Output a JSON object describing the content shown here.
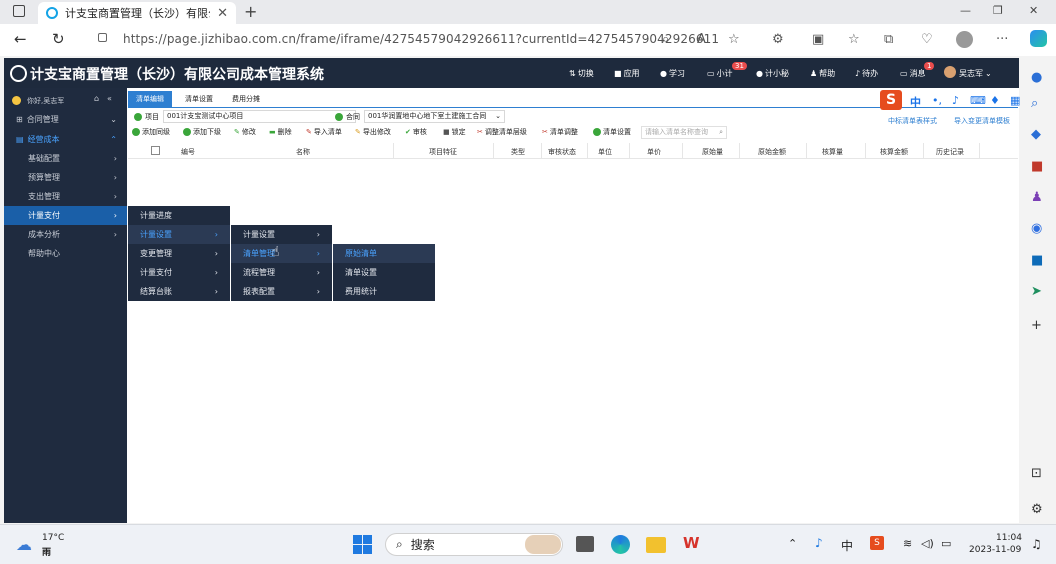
{
  "browser": {
    "tab_title": "计支宝商置管理（长沙）有限公",
    "tab_close": "✕",
    "new_tab": "+",
    "url": "https://page.jizhibao.com.cn/frame/iframe/427545790429266​11?currentId=42754579042926611",
    "window_min": "—",
    "window_max": "❐",
    "window_close": "✕",
    "more": "···"
  },
  "app": {
    "title": "计支宝商置管理（长沙）有限公司成本管理系统",
    "header": {
      "switch": "切换",
      "apps": "应用",
      "learn": "学习",
      "xiaoji": "小计",
      "xiaoji_badge": "31",
      "jixiaomi": "计小秘",
      "help": "帮助",
      "todo": "待办",
      "messages": "消息",
      "messages_badge": "1",
      "user": "吴志军"
    }
  },
  "sidebar": {
    "greeting": "你好,吴志军",
    "items": [
      {
        "label": "合同管理"
      },
      {
        "label": "经营成本"
      },
      {
        "label": "基础配置"
      },
      {
        "label": "预算管理"
      },
      {
        "label": "支出管理"
      },
      {
        "label": "计量支付"
      },
      {
        "label": "成本分析"
      },
      {
        "label": "帮助中心"
      }
    ]
  },
  "content": {
    "tabs": [
      "清单编辑",
      "清单设置",
      "费用分摊"
    ],
    "project_label": "项目",
    "project_value": "001计支宝测试中心项目",
    "contract_label": "合同",
    "contract_value": "001华润置地中心地下室土建施工合同",
    "right_links": [
      "中标清单表样式",
      "导入变更清单模板"
    ],
    "toolbar": [
      "添加同级",
      "添加下级",
      "修改",
      "删除",
      "导入清单",
      "导出修改",
      "审核",
      "锁定",
      "调整清单层级",
      "清单调整",
      "清单设置"
    ],
    "search_placeholder": "请输入清单名称查询",
    "columns": [
      "编号",
      "名称",
      "项目特征",
      "类型",
      "审核状态",
      "单位",
      "单价",
      "原始量",
      "原始金额",
      "核算量",
      "核算金额",
      "历史记录"
    ]
  },
  "menus": {
    "level1": [
      "计量进度",
      "计量设置",
      "变更管理",
      "计量支付",
      "结算台账"
    ],
    "level2": [
      "计量设置",
      "清单管理",
      "流程管理",
      "报表配置"
    ],
    "level3": [
      "原始清单",
      "清单设置",
      "费用统计"
    ]
  },
  "taskbar": {
    "temp": "17°C",
    "weather": "雨",
    "search_placeholder": "搜索",
    "ime": "中",
    "time": "11:04",
    "date": "2023-11-09"
  }
}
